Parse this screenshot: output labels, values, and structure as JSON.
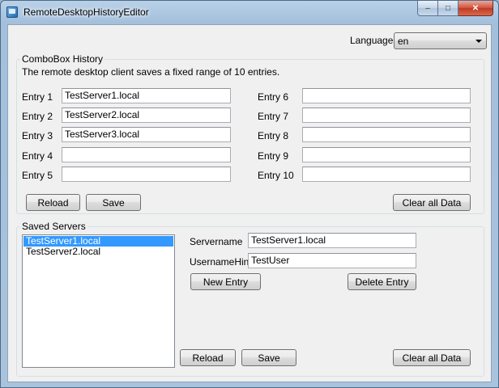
{
  "window": {
    "title": "RemoteDesktopHistoryEditor",
    "minimize_label": "–",
    "maximize_label": "□",
    "close_label": "✕"
  },
  "language": {
    "label": "Language",
    "selected": "en"
  },
  "combobox_history": {
    "title": "ComboBox History",
    "description": "The remote desktop client saves a fixed range of 10 entries.",
    "entries": [
      {
        "label": "Entry 1",
        "value": "TestServer1.local"
      },
      {
        "label": "Entry 2",
        "value": "TestServer2.local"
      },
      {
        "label": "Entry 3",
        "value": "TestServer3.local"
      },
      {
        "label": "Entry 4",
        "value": ""
      },
      {
        "label": "Entry 5",
        "value": ""
      },
      {
        "label": "Entry 6",
        "value": ""
      },
      {
        "label": "Entry 7",
        "value": ""
      },
      {
        "label": "Entry 8",
        "value": ""
      },
      {
        "label": "Entry 9",
        "value": ""
      },
      {
        "label": "Entry 10",
        "value": ""
      }
    ],
    "reload_label": "Reload",
    "save_label": "Save",
    "clear_label": "Clear all Data"
  },
  "saved_servers": {
    "title": "Saved Servers",
    "servers": [
      "TestServer1.local",
      "TestServer2.local"
    ],
    "selected_index": 0,
    "servername_label": "Servername",
    "servername_value": "TestServer1.local",
    "username_hint_label": "UsernameHint",
    "username_hint_value": "TestUser",
    "new_entry_label": "New Entry",
    "delete_entry_label": "Delete Entry",
    "reload_label": "Reload",
    "save_label": "Save",
    "clear_label": "Clear all Data"
  }
}
